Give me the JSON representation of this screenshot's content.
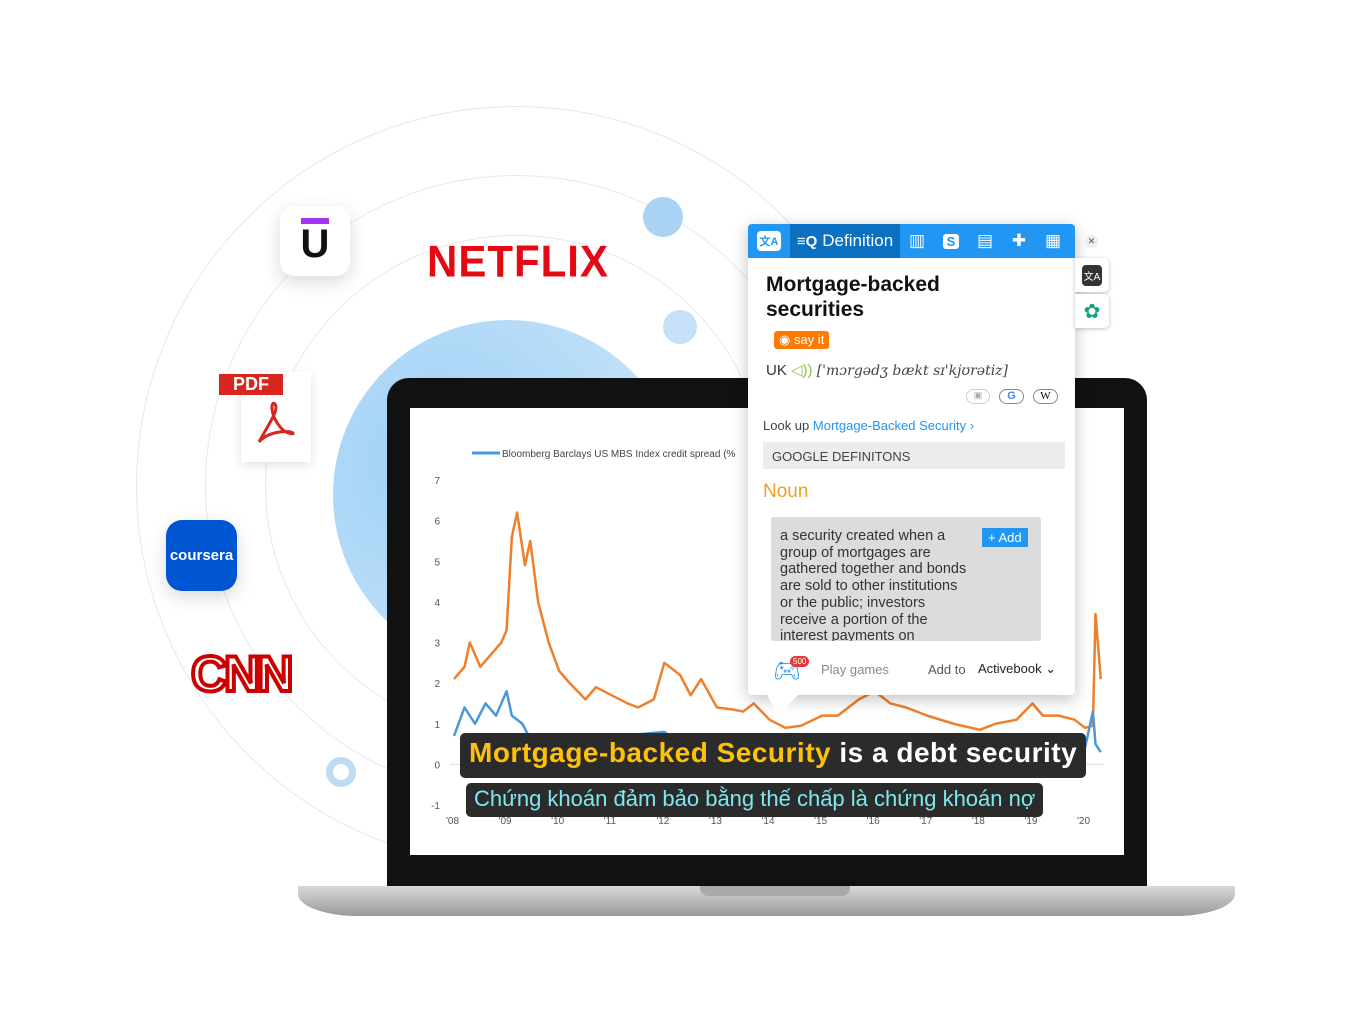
{
  "logos": {
    "netflix": "NETFLIX",
    "pdf": "PDF",
    "coursera": "coursera",
    "cnn": "CNN",
    "udemy": "U"
  },
  "popup": {
    "tabs": [
      {
        "icon": "translate-icon"
      },
      {
        "icon": "definition-icon",
        "label": "Definition"
      },
      {
        "icon": "book-icon"
      },
      {
        "icon": "skype-icon"
      },
      {
        "icon": "comment-icon"
      },
      {
        "icon": "puzzle-icon"
      },
      {
        "icon": "notes-icon"
      }
    ],
    "word": "Mortgage-backed securities",
    "say_it": "say it",
    "accent": "UK",
    "ipa": "['mɔrgədʒ bækt sɪ'kjʊrətiz]",
    "lookup_label": "Look up",
    "lookup_link": "Mortgage-Backed Security",
    "section": "GOOGLE DEFINITONS",
    "pos": "Noun",
    "definition": "a security created when a group of mortgages are gathered together and bonds are sold to other institutions or the public; investors receive a portion of the interest payments on",
    "add_label": "+ Add",
    "games_badge": "500",
    "play_games": "Play games",
    "add_to": "Add to",
    "book": "Activebook",
    "colors": {
      "tab_bar": "#2196f3",
      "say_it": "#ff7a00",
      "noun": "#f0a020",
      "link": "#2196f3"
    }
  },
  "subtitles": {
    "highlight": "Mortgage-backed Security",
    "rest": " is a debt security",
    "translation": "Chứng khoán đảm bảo bằng thế chấp là chứng khoán nợ",
    "colors": {
      "highlight": "#ffc107",
      "translation": "#7ee8f0"
    }
  },
  "chart_data": {
    "type": "line",
    "legend": "Bloomberg Barclays US MBS Index credit spread (%",
    "x_ticks": [
      "'08",
      "'09",
      "'10",
      "'11",
      "'12",
      "'13",
      "'14",
      "'15",
      "'16",
      "'17",
      "'18",
      "'19",
      "'20"
    ],
    "y_ticks": [
      "7",
      "6",
      "5",
      "4",
      "3",
      "2",
      "1",
      "0",
      "-1"
    ],
    "ylim": [
      -1,
      7
    ],
    "xlim": [
      2008,
      2020.3
    ],
    "series": [
      {
        "color": "#f07f2a",
        "x": [
          2008.0,
          2008.2,
          2008.3,
          2008.5,
          2008.7,
          2008.9,
          2009.0,
          2009.1,
          2009.2,
          2009.35,
          2009.45,
          2009.6,
          2009.8,
          2010.0,
          2010.2,
          2010.5,
          2010.7,
          2011.0,
          2011.3,
          2011.5,
          2011.8,
          2012.0,
          2012.3,
          2012.5,
          2012.7,
          2013.0,
          2013.3,
          2013.5,
          2013.7,
          2014.0,
          2014.3,
          2014.6,
          2015.0,
          2015.3,
          2015.7,
          2016.0,
          2016.3,
          2016.6,
          2017.0,
          2017.5,
          2018.0,
          2018.3,
          2018.7,
          2019.0,
          2019.2,
          2019.5,
          2019.8,
          2020.0,
          2020.15,
          2020.2,
          2020.3
        ],
        "y": [
          2.1,
          2.4,
          3.0,
          2.4,
          2.7,
          3.0,
          3.3,
          5.6,
          6.2,
          4.9,
          5.5,
          4.0,
          3.0,
          2.3,
          2.0,
          1.6,
          1.9,
          1.7,
          1.5,
          1.4,
          1.6,
          2.5,
          2.2,
          1.7,
          2.1,
          1.4,
          1.35,
          1.3,
          1.5,
          1.1,
          0.9,
          0.95,
          1.2,
          1.2,
          1.6,
          1.8,
          1.5,
          1.4,
          1.2,
          1.0,
          0.85,
          1.0,
          1.1,
          1.5,
          1.2,
          1.2,
          1.1,
          0.9,
          0.95,
          3.7,
          2.1
        ]
      },
      {
        "name": "Bloomberg Barclays US MBS Index credit spread (%",
        "color": "#4a98da",
        "x": [
          2008.0,
          2008.2,
          2008.4,
          2008.6,
          2008.8,
          2009.0,
          2009.1,
          2009.3,
          2009.5,
          2012.0,
          2012.3,
          2020.0,
          2020.15,
          2020.2,
          2020.3
        ],
        "y": [
          0.7,
          1.4,
          1.0,
          1.5,
          1.2,
          1.8,
          1.2,
          1.0,
          0.5,
          0.8,
          0.5,
          0.4,
          1.3,
          0.5,
          0.3
        ]
      }
    ]
  }
}
